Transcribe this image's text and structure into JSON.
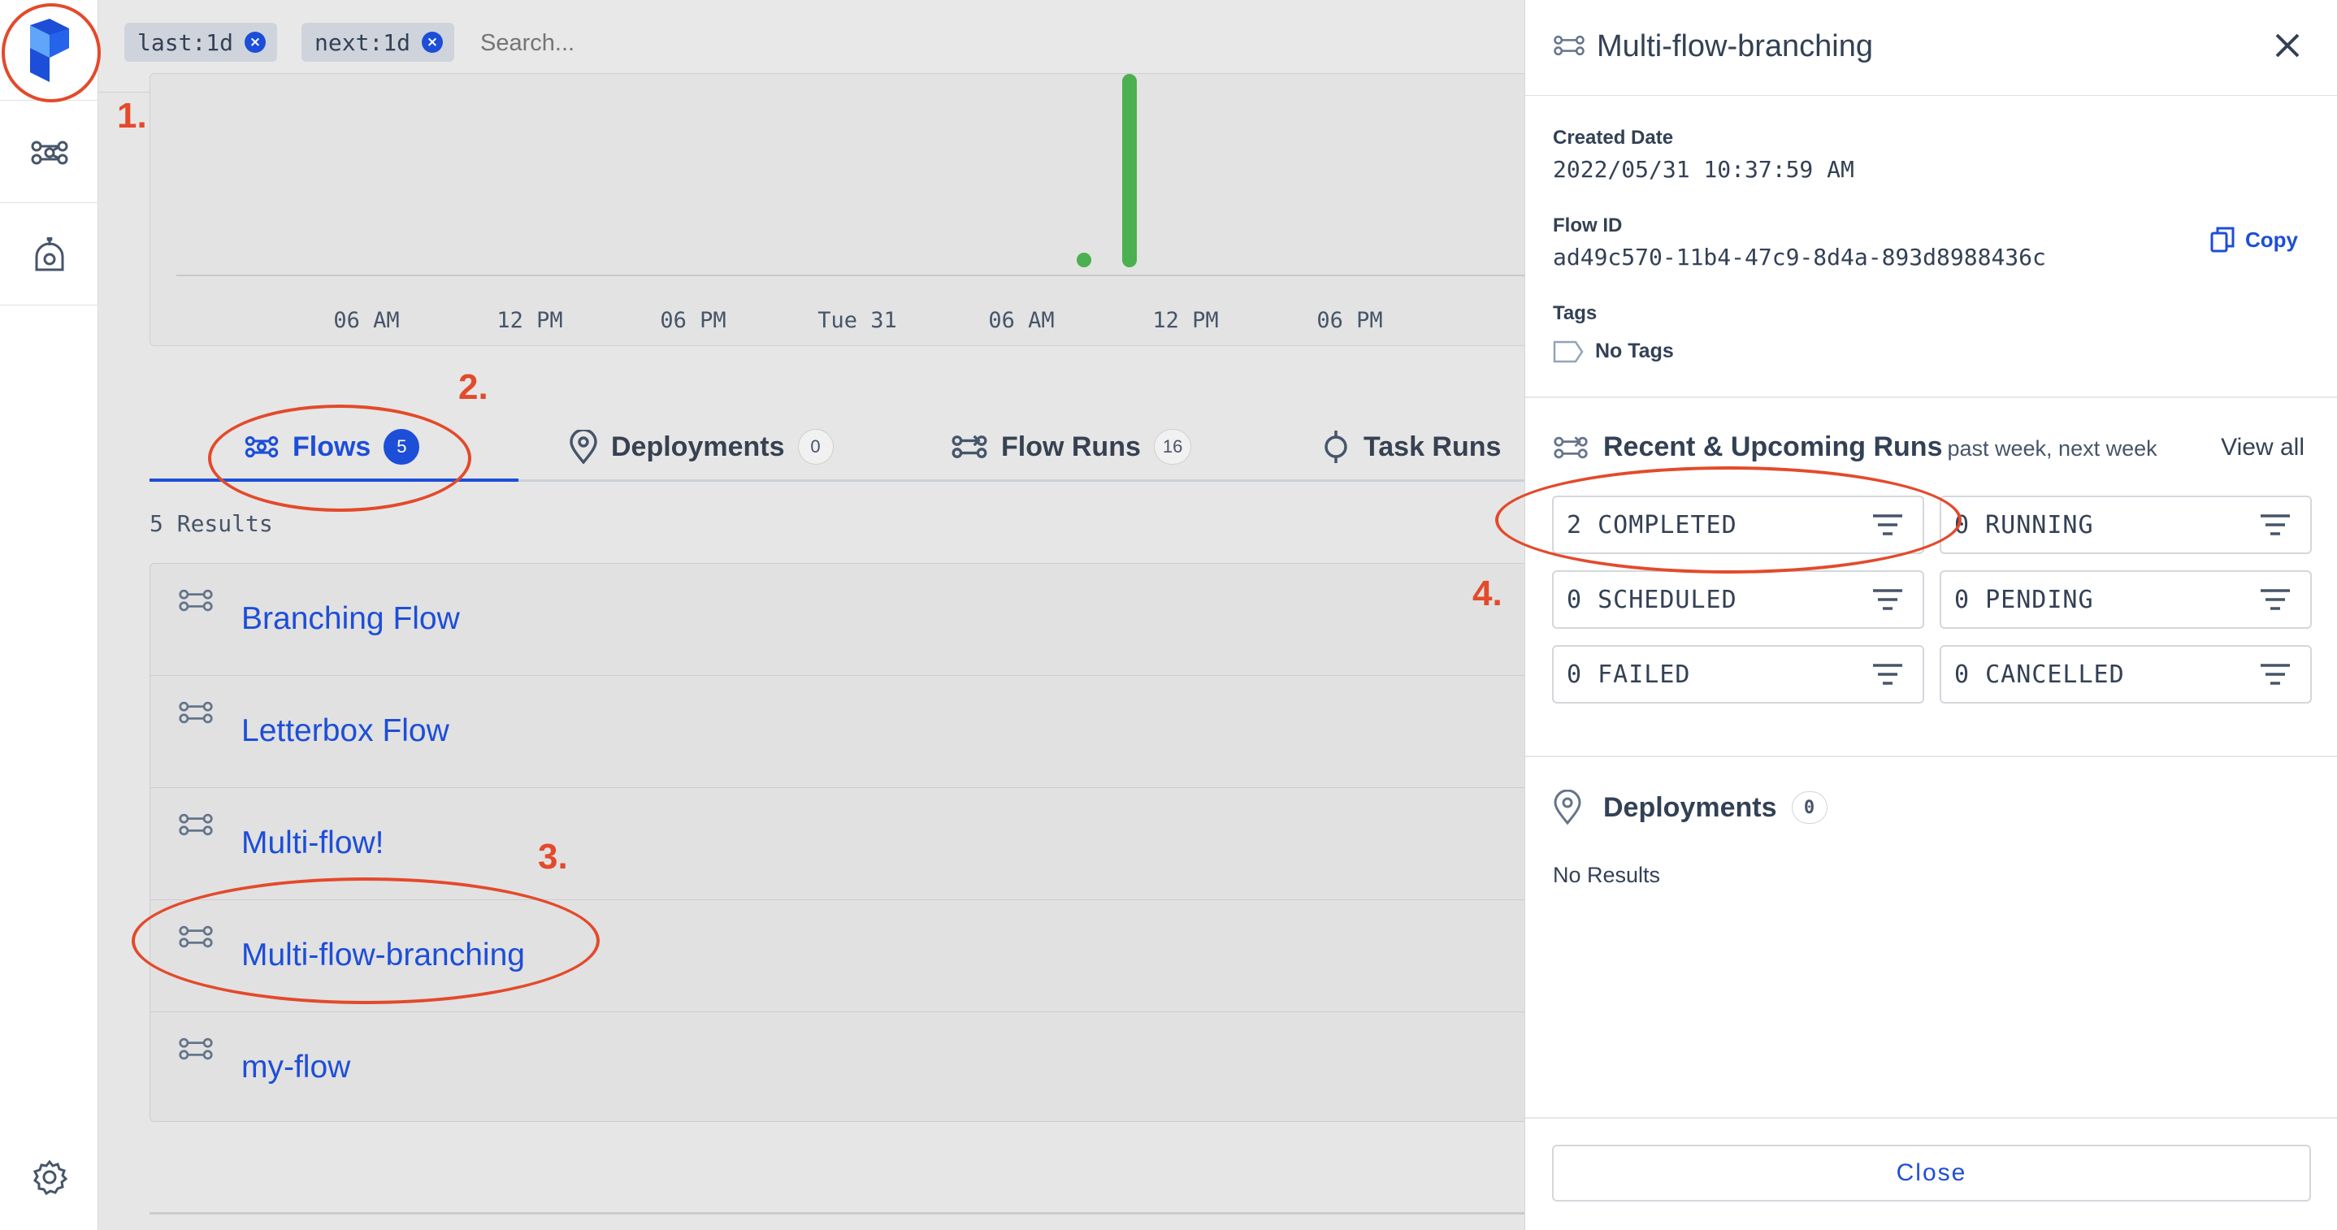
{
  "filters": {
    "chips": [
      {
        "label": "last:1d"
      },
      {
        "label": "next:1d"
      }
    ],
    "search_placeholder": "Search..."
  },
  "chart": {
    "x_labels": [
      "06 AM",
      "12 PM",
      "06 PM",
      "Tue 31",
      "06 AM",
      "12 PM",
      "06 PM"
    ]
  },
  "tabs": [
    {
      "label": "Flows",
      "count": "5"
    },
    {
      "label": "Deployments",
      "count": "0"
    },
    {
      "label": "Flow Runs",
      "count": "16"
    },
    {
      "label": "Task Runs",
      "count": ""
    }
  ],
  "results_label": "5 Results",
  "flows": [
    {
      "name": "Branching Flow"
    },
    {
      "name": "Letterbox Flow"
    },
    {
      "name": "Multi-flow!"
    },
    {
      "name": "Multi-flow-branching"
    },
    {
      "name": "my-flow"
    }
  ],
  "panel": {
    "title": "Multi-flow-branching",
    "created_label": "Created Date",
    "created_value": "2022/05/31 10:37:59 AM",
    "flow_id_label": "Flow ID",
    "flow_id_value": "ad49c570-11b4-47c9-8d4a-893d8988436c",
    "copy_label": "Copy",
    "tags_label": "Tags",
    "no_tags": "No Tags",
    "runs_title": "Recent & Upcoming Runs",
    "runs_subtitle": "past week, next week",
    "view_all": "View all",
    "states": [
      {
        "text": "2 COMPLETED"
      },
      {
        "text": "0 RUNNING"
      },
      {
        "text": "0 SCHEDULED"
      },
      {
        "text": "0 PENDING"
      },
      {
        "text": "0 FAILED"
      },
      {
        "text": "0 CANCELLED"
      }
    ],
    "deployments_title": "Deployments",
    "deployments_count": "0",
    "no_results": "No Results",
    "close_label": "Close"
  },
  "annotations": [
    "1.",
    "2.",
    "3.",
    "4."
  ],
  "colors": {
    "accent": "#1d4ed8",
    "annotation": "#e34a2b",
    "chart_bar": "#4caf50"
  }
}
